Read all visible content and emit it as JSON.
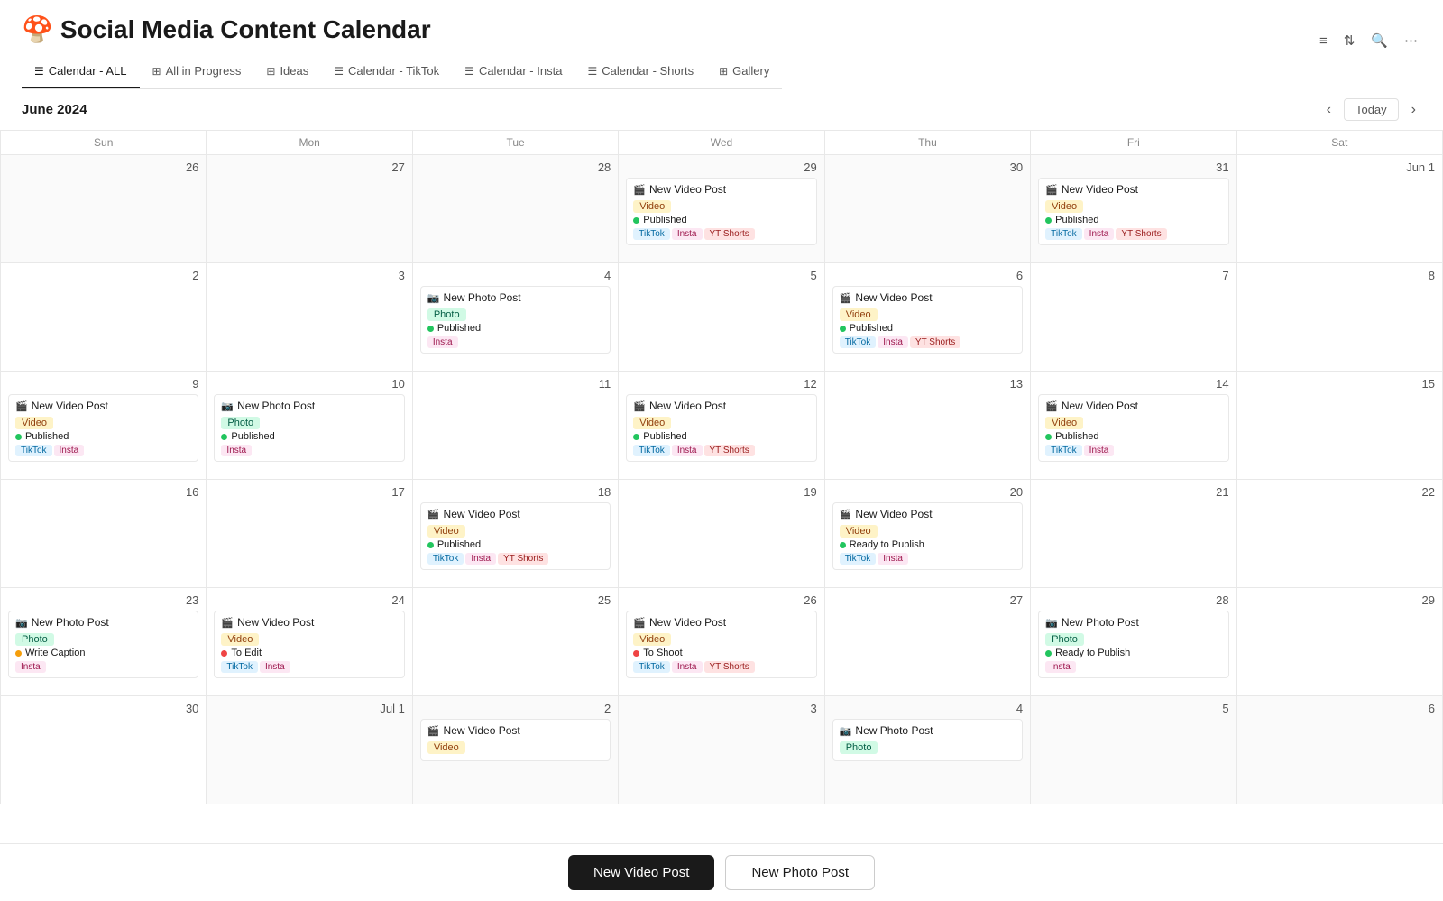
{
  "page": {
    "title": "Social Media Content Calendar",
    "emoji": "🍄",
    "month_label": "June 2024",
    "today_label": "Today"
  },
  "nav": {
    "tabs": [
      {
        "id": "calendar-all",
        "label": "Calendar - ALL",
        "icon": "☰",
        "active": true
      },
      {
        "id": "all-in-progress",
        "label": "All in Progress",
        "icon": "⊞",
        "active": false
      },
      {
        "id": "ideas",
        "label": "Ideas",
        "icon": "⊞",
        "active": false
      },
      {
        "id": "calendar-tiktok",
        "label": "Calendar - TikTok",
        "icon": "☰",
        "active": false
      },
      {
        "id": "calendar-insta",
        "label": "Calendar - Insta",
        "icon": "☰",
        "active": false
      },
      {
        "id": "calendar-shorts",
        "label": "Calendar - Shorts",
        "icon": "☰",
        "active": false
      },
      {
        "id": "gallery",
        "label": "Gallery",
        "icon": "⊞",
        "active": false
      }
    ]
  },
  "days_of_week": [
    "Sun",
    "Mon",
    "Tue",
    "Wed",
    "Thu",
    "Fri",
    "Sat"
  ],
  "calendar": {
    "weeks": [
      {
        "days": [
          {
            "num": "26",
            "other_month": true,
            "today": false,
            "events": []
          },
          {
            "num": "27",
            "other_month": true,
            "today": false,
            "events": []
          },
          {
            "num": "28",
            "other_month": true,
            "today": false,
            "events": []
          },
          {
            "num": "29",
            "other_month": true,
            "today": false,
            "events": [
              {
                "title": "New Video Post",
                "emoji": "🎬",
                "type": "video",
                "status": "Published",
                "status_class": "published",
                "platforms": [
                  "TikTok",
                  "Insta",
                  "YT Shorts"
                ]
              }
            ]
          },
          {
            "num": "30",
            "other_month": true,
            "today": false,
            "events": []
          },
          {
            "num": "31",
            "other_month": true,
            "today": false,
            "events": [
              {
                "title": "New Video Post",
                "emoji": "🎬",
                "type": "video",
                "status": "Published",
                "status_class": "published",
                "platforms": [
                  "TikTok",
                  "Insta",
                  "YT Shorts"
                ]
              }
            ]
          },
          {
            "num": "Jun 1",
            "other_month": false,
            "today": false,
            "events": []
          }
        ]
      },
      {
        "days": [
          {
            "num": "2",
            "other_month": false,
            "today": false,
            "events": []
          },
          {
            "num": "3",
            "other_month": false,
            "today": false,
            "events": []
          },
          {
            "num": "4",
            "other_month": false,
            "today": false,
            "events": [
              {
                "title": "New Photo Post",
                "emoji": "📷",
                "type": "photo",
                "status": "Published",
                "status_class": "published",
                "platforms": [
                  "Insta"
                ]
              }
            ]
          },
          {
            "num": "5",
            "other_month": false,
            "today": false,
            "events": []
          },
          {
            "num": "6",
            "other_month": false,
            "today": false,
            "events": [
              {
                "title": "New Video Post",
                "emoji": "🎬",
                "type": "video",
                "status": "Published",
                "status_class": "published",
                "platforms": [
                  "TikTok",
                  "Insta",
                  "YT Shorts"
                ]
              }
            ]
          },
          {
            "num": "7",
            "other_month": false,
            "today": false,
            "events": []
          },
          {
            "num": "8",
            "other_month": false,
            "today": false,
            "events": []
          }
        ]
      },
      {
        "days": [
          {
            "num": "9",
            "other_month": false,
            "today": false,
            "events": [
              {
                "title": "New Video Post",
                "emoji": "🎬",
                "type": "video",
                "status": "Published",
                "status_class": "published",
                "platforms": [
                  "TikTok",
                  "Insta"
                ]
              }
            ]
          },
          {
            "num": "10",
            "other_month": false,
            "today": false,
            "events": [
              {
                "title": "New Photo Post",
                "emoji": "📷",
                "type": "photo",
                "status": "Published",
                "status_class": "published",
                "platforms": [
                  "Insta"
                ]
              }
            ]
          },
          {
            "num": "11",
            "other_month": false,
            "today": false,
            "events": []
          },
          {
            "num": "12",
            "other_month": false,
            "today": false,
            "events": [
              {
                "title": "New Video Post",
                "emoji": "🎬",
                "type": "video",
                "status": "Published",
                "status_class": "published",
                "platforms": [
                  "TikTok",
                  "Insta",
                  "YT Shorts"
                ]
              }
            ]
          },
          {
            "num": "13",
            "other_month": false,
            "today": false,
            "events": []
          },
          {
            "num": "14",
            "other_month": false,
            "today": false,
            "events": [
              {
                "title": "New Video Post",
                "emoji": "🎬",
                "type": "video",
                "status": "Published",
                "status_class": "published",
                "platforms": [
                  "TikTok",
                  "Insta"
                ]
              }
            ]
          },
          {
            "num": "15",
            "other_month": false,
            "today": false,
            "events": []
          }
        ]
      },
      {
        "days": [
          {
            "num": "16",
            "other_month": false,
            "today": false,
            "events": []
          },
          {
            "num": "17",
            "other_month": false,
            "today": false,
            "events": []
          },
          {
            "num": "18",
            "other_month": false,
            "today": false,
            "events": [
              {
                "title": "New Video Post",
                "emoji": "🎬",
                "type": "video",
                "status": "Published",
                "status_class": "published",
                "platforms": [
                  "TikTok",
                  "Insta",
                  "YT Shorts"
                ]
              }
            ]
          },
          {
            "num": "19",
            "other_month": false,
            "today": false,
            "events": []
          },
          {
            "num": "20",
            "other_month": false,
            "today": false,
            "events": [
              {
                "title": "New Video Post",
                "emoji": "🎬",
                "type": "video",
                "status": "Ready to Publish",
                "status_class": "ready",
                "platforms": [
                  "TikTok",
                  "Insta"
                ]
              }
            ]
          },
          {
            "num": "21",
            "other_month": false,
            "today": false,
            "events": []
          },
          {
            "num": "22",
            "other_month": false,
            "today": false,
            "events": []
          }
        ]
      },
      {
        "days": [
          {
            "num": "23",
            "other_month": false,
            "today": false,
            "events": [
              {
                "title": "New Photo Post",
                "emoji": "📷",
                "type": "photo",
                "status": "Write Caption",
                "status_class": "write-caption",
                "platforms": [
                  "Insta"
                ]
              }
            ]
          },
          {
            "num": "24",
            "other_month": false,
            "today": false,
            "events": [
              {
                "title": "New Video Post",
                "emoji": "🎬",
                "type": "video",
                "status": "To Edit",
                "status_class": "to-edit",
                "platforms": [
                  "TikTok",
                  "Insta"
                ]
              }
            ]
          },
          {
            "num": "25",
            "other_month": false,
            "today": false,
            "events": []
          },
          {
            "num": "26",
            "other_month": false,
            "today": true,
            "events": [
              {
                "title": "New Video Post",
                "emoji": "🎬",
                "type": "video",
                "status": "To Shoot",
                "status_class": "to-shoot",
                "platforms": [
                  "TikTok",
                  "Insta",
                  "YT Shorts"
                ]
              }
            ]
          },
          {
            "num": "27",
            "other_month": false,
            "today": false,
            "events": []
          },
          {
            "num": "28",
            "other_month": false,
            "today": false,
            "events": [
              {
                "title": "New Photo Post",
                "emoji": "📷",
                "type": "photo",
                "status": "Ready to Publish",
                "status_class": "ready",
                "platforms": [
                  "Insta"
                ]
              }
            ]
          },
          {
            "num": "29",
            "other_month": false,
            "today": false,
            "events": []
          }
        ]
      },
      {
        "days": [
          {
            "num": "30",
            "other_month": false,
            "today": false,
            "events": []
          },
          {
            "num": "Jul 1",
            "other_month": true,
            "today": false,
            "events": []
          },
          {
            "num": "2",
            "other_month": true,
            "today": false,
            "events": [
              {
                "title": "New Video Post",
                "emoji": "🎬",
                "type": "video",
                "status": "",
                "status_class": "",
                "platforms": []
              }
            ]
          },
          {
            "num": "3",
            "other_month": true,
            "today": false,
            "events": []
          },
          {
            "num": "4",
            "other_month": true,
            "today": false,
            "events": [
              {
                "title": "New Photo Post",
                "emoji": "📷",
                "type": "photo",
                "status": "",
                "status_class": "",
                "platforms": []
              }
            ]
          },
          {
            "num": "5",
            "other_month": true,
            "today": false,
            "events": []
          },
          {
            "num": "6",
            "other_month": true,
            "today": false,
            "events": []
          }
        ]
      }
    ]
  },
  "bottom_bar": {
    "video_btn": "New Video Post",
    "photo_btn": "New Photo Post"
  }
}
